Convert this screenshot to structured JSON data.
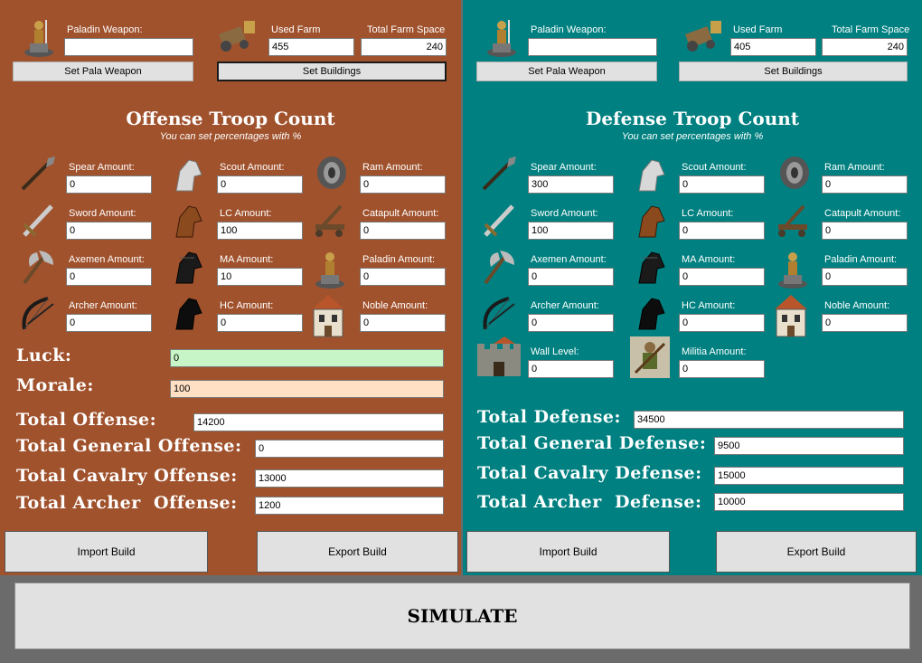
{
  "offense": {
    "top": {
      "paladin_weapon_label": "Paladin Weapon:",
      "paladin_weapon_value": "",
      "used_farm_label": "Used Farm",
      "used_farm_value": "455",
      "total_farm_label": "Total Farm Space",
      "total_farm_value": "240",
      "set_pala_button": "Set Pala Weapon",
      "set_buildings_button": "Set Buildings"
    },
    "title": "Offense Troop Count",
    "subtitle": "You can set percentages with %",
    "troops": [
      {
        "label": "Spear Amount:",
        "value": "0",
        "icon": "spear-icon"
      },
      {
        "label": "Scout Amount:",
        "value": "0",
        "icon": "scout-horse-icon"
      },
      {
        "label": "Ram Amount:",
        "value": "0",
        "icon": "ram-icon"
      },
      {
        "label": "Sword Amount:",
        "value": "0",
        "icon": "sword-icon"
      },
      {
        "label": "LC Amount:",
        "value": "100",
        "icon": "light-cavalry-icon"
      },
      {
        "label": "Catapult Amount:",
        "value": "0",
        "icon": "catapult-icon"
      },
      {
        "label": "Axemen Amount:",
        "value": "0",
        "icon": "axe-icon"
      },
      {
        "label": "MA Amount:",
        "value": "10",
        "icon": "mounted-archer-icon"
      },
      {
        "label": "Paladin Amount:",
        "value": "0",
        "icon": "paladin-icon"
      },
      {
        "label": "Archer Amount:",
        "value": "0",
        "icon": "archer-bow-icon"
      },
      {
        "label": "HC Amount:",
        "value": "0",
        "icon": "heavy-cavalry-icon"
      },
      {
        "label": "Noble Amount:",
        "value": "0",
        "icon": "noble-house-icon"
      }
    ],
    "luck_label": "Luck:",
    "luck_value": "0",
    "morale_label": "Morale:",
    "morale_value": "100",
    "totals": [
      {
        "label": "Total Offense:",
        "value": "14200"
      },
      {
        "label": "Total General Offense:",
        "value": "0"
      },
      {
        "label": "Total Cavalry Offense:",
        "value": "13000"
      },
      {
        "label": "Total Archer  Offense:",
        "value": "1200"
      }
    ],
    "import_button": "Import Build",
    "export_button": "Export Build"
  },
  "defense": {
    "top": {
      "paladin_weapon_label": "Paladin Weapon:",
      "paladin_weapon_value": "",
      "used_farm_label": "Used Farm",
      "used_farm_value": "405",
      "total_farm_label": "Total Farm Space",
      "total_farm_value": "240",
      "set_pala_button": "Set Pala Weapon",
      "set_buildings_button": "Set Buildings"
    },
    "title": "Defense Troop Count",
    "subtitle": "You can set percentages with %",
    "troops": [
      {
        "label": "Spear Amount:",
        "value": "300",
        "icon": "spear-icon"
      },
      {
        "label": "Scout Amount:",
        "value": "0",
        "icon": "scout-horse-icon"
      },
      {
        "label": "Ram Amount:",
        "value": "0",
        "icon": "ram-icon"
      },
      {
        "label": "Sword Amount:",
        "value": "100",
        "icon": "sword-icon"
      },
      {
        "label": "LC Amount:",
        "value": "0",
        "icon": "light-cavalry-icon"
      },
      {
        "label": "Catapult Amount:",
        "value": "0",
        "icon": "catapult-icon"
      },
      {
        "label": "Axemen Amount:",
        "value": "0",
        "icon": "axe-icon"
      },
      {
        "label": "MA Amount:",
        "value": "0",
        "icon": "mounted-archer-icon"
      },
      {
        "label": "Paladin Amount:",
        "value": "0",
        "icon": "paladin-icon"
      },
      {
        "label": "Archer Amount:",
        "value": "0",
        "icon": "archer-bow-icon"
      },
      {
        "label": "HC Amount:",
        "value": "0",
        "icon": "heavy-cavalry-icon"
      },
      {
        "label": "Noble Amount:",
        "value": "0",
        "icon": "noble-house-icon"
      },
      {
        "label": "Wall Level:",
        "value": "0",
        "icon": "wall-tower-icon"
      },
      {
        "label": "Militia Amount:",
        "value": "0",
        "icon": "militia-icon"
      }
    ],
    "totals": [
      {
        "label": "Total Defense:",
        "value": "34500"
      },
      {
        "label": "Total General Defense:",
        "value": "9500"
      },
      {
        "label": "Total Cavalry Defense:",
        "value": "15000"
      },
      {
        "label": "Total Archer  Defense:",
        "value": "10000"
      }
    ],
    "import_button": "Import Build",
    "export_button": "Export Build"
  },
  "simulate_button": "SIMULATE",
  "colors": {
    "offense_panel": "#a0522d",
    "defense_panel": "#008080",
    "luck_field": "#c8f5c8",
    "morale_field": "#ffe0c4"
  }
}
